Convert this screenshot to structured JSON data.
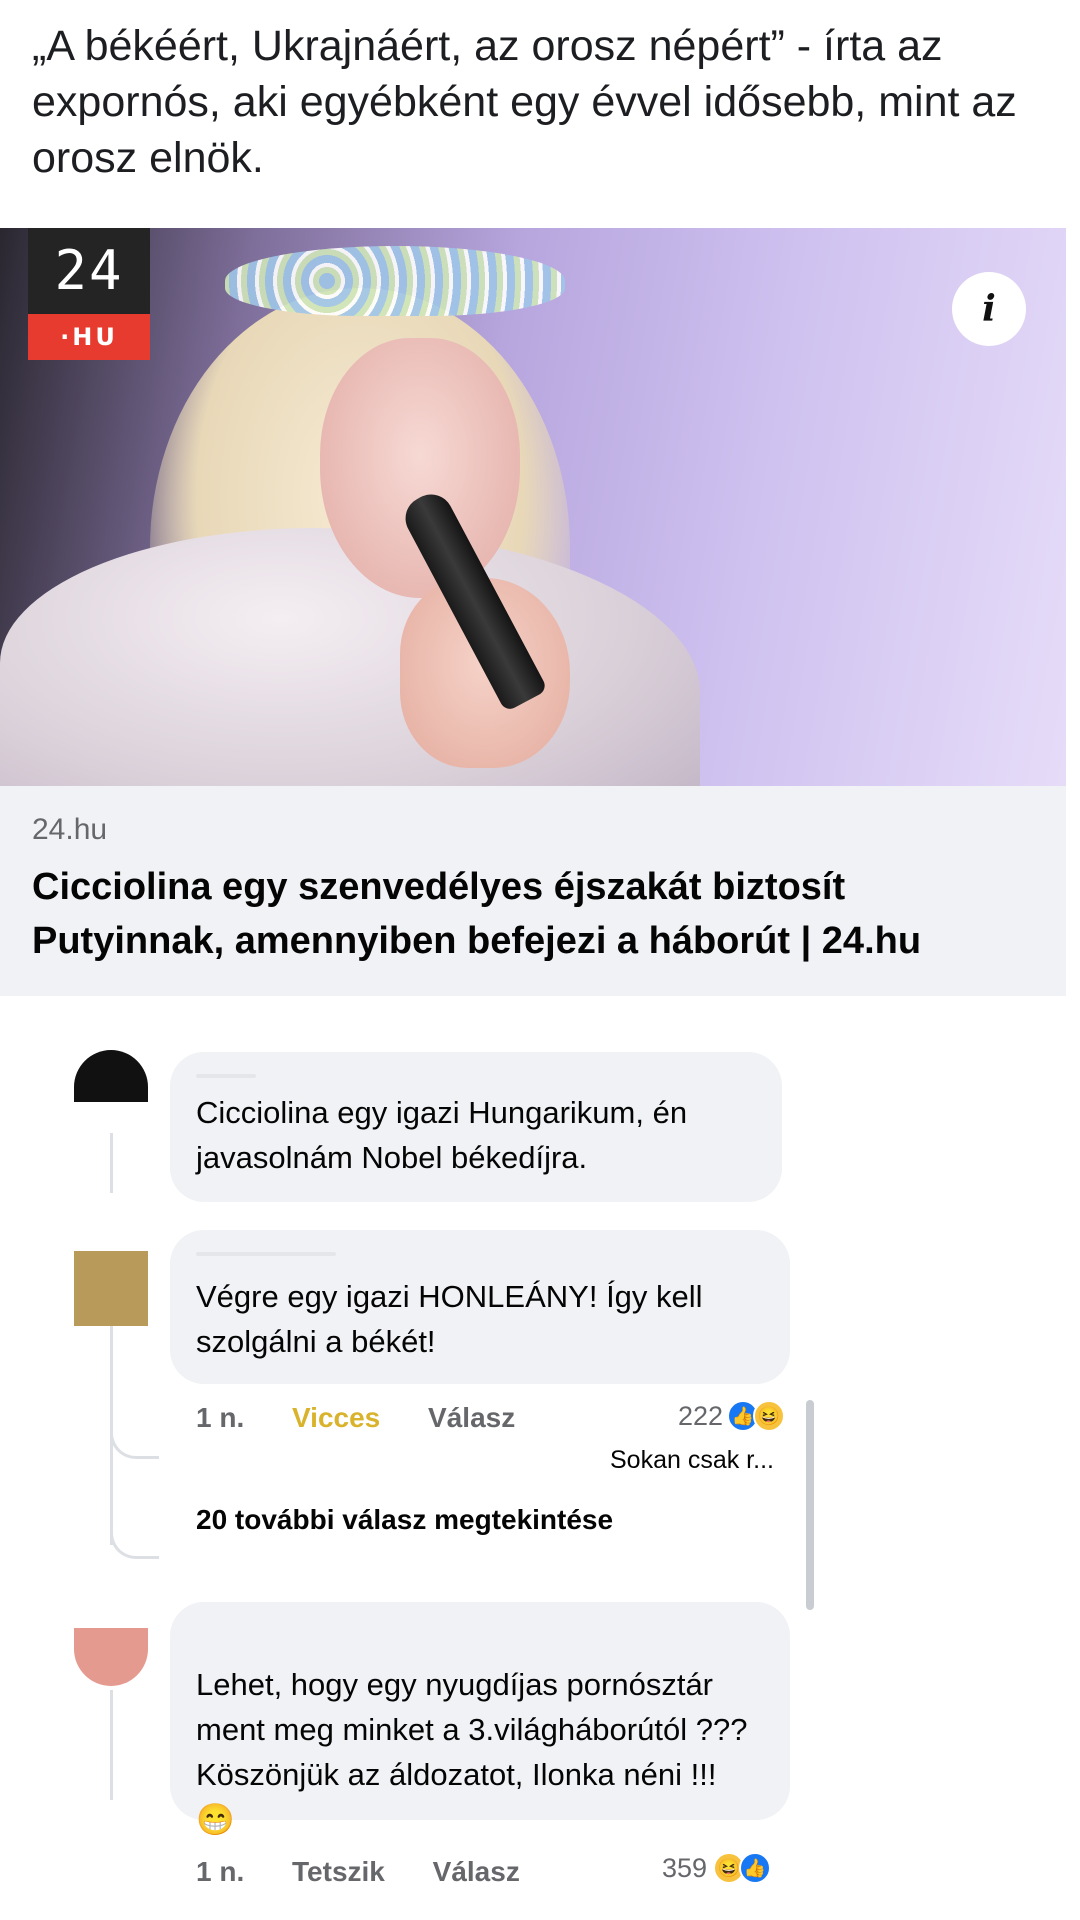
{
  "post": {
    "text": "„A békéért, Ukrajnáért, az orosz népért” - írta az expornós, aki egyébként egy évvel idősebb, mint az orosz elnök."
  },
  "link_card": {
    "logo_top": "24",
    "logo_bottom": "·HU",
    "info_icon": "i",
    "domain": "24.hu",
    "title": "Cicciolina egy szenvedélyes éjszakát biztosít Putyinnak, amennyiben befejezi a háborút | 24.hu"
  },
  "comments": [
    {
      "text": "Cicciolina egy igazi Hungarikum, én javasolnám Nobel békedíjra.",
      "avatar_color": "#111111"
    },
    {
      "text": "Végre egy igazi HONLEÁNY! Így kell szolgálni a békét!",
      "avatar_color": "#b89a5a",
      "time": "1 n.",
      "reaction_label": "Vicces",
      "reply_label": "Válasz",
      "reaction_count": "222",
      "reaction_icons": [
        "like-icon",
        "haha-icon"
      ]
    },
    {
      "text": "Lehet, hogy egy nyugdíjas pornósztár ment meg minket a 3.világháborútól ??? Köszönjük az áldozatot, Ilonka néni !!! 😁",
      "avatar_color": "#e59a90",
      "time": "1 n.",
      "reaction_label": "Tetszik",
      "reply_label": "Válasz",
      "reaction_count": "359",
      "reaction_icons": [
        "haha-icon",
        "like-icon"
      ]
    }
  ],
  "replies": {
    "preview_text": "Sokan csak r...",
    "more_label": "20 további válasz megtekintése"
  },
  "colors": {
    "bubble_bg": "#f0f2f5",
    "secondary_text": "#65676b",
    "vicces": "#d9b32c",
    "like_blue": "#1877f2",
    "haha_yellow": "#f7c23d"
  }
}
